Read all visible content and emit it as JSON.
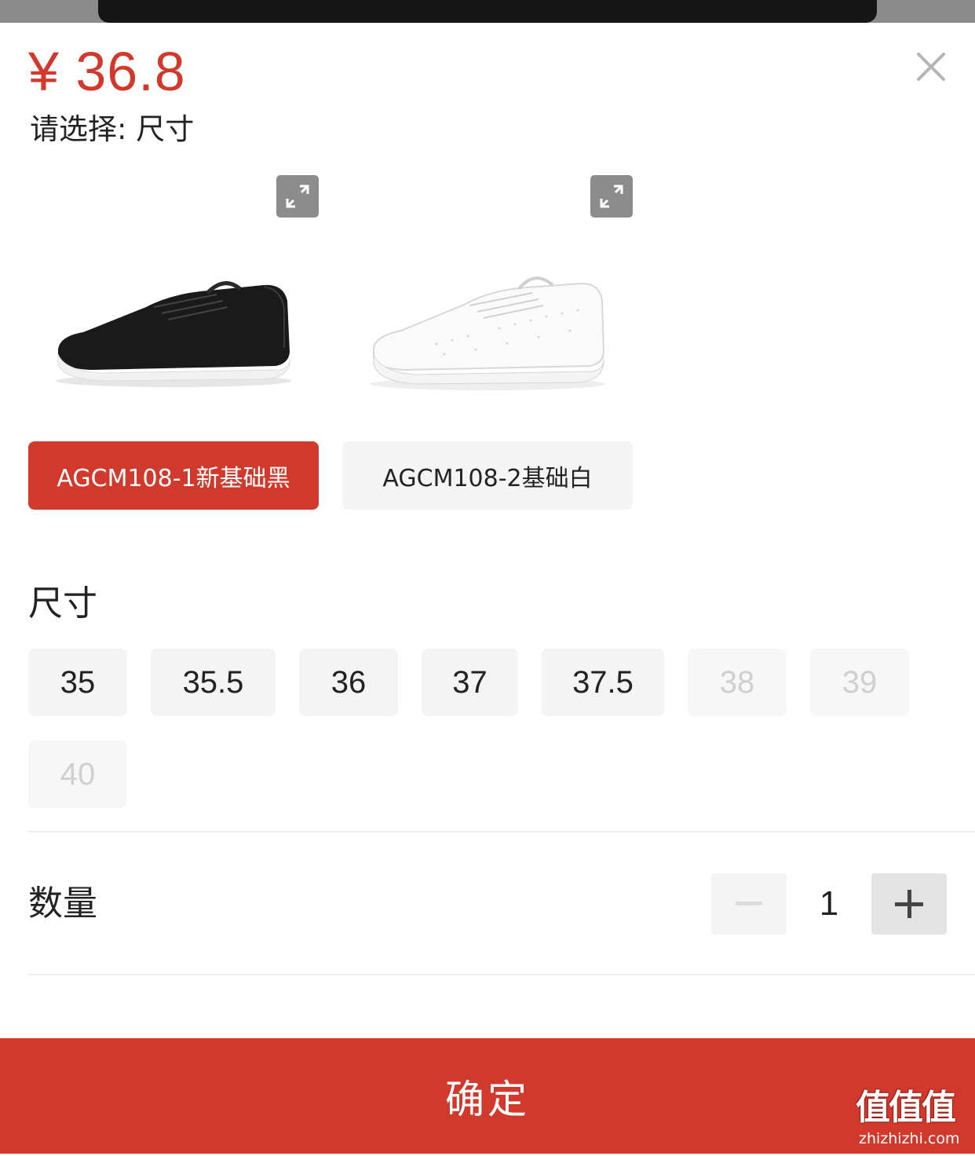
{
  "price": "¥ 36.8",
  "prompt": "请选择: 尺寸",
  "variants": [
    {
      "label": "AGCM108-1新基础黑",
      "selected": true,
      "image": "black-sneaker"
    },
    {
      "label": "AGCM108-2基础白",
      "selected": false,
      "image": "white-sneaker"
    }
  ],
  "size_section": {
    "title": "尺寸",
    "sizes": [
      {
        "label": "35",
        "available": true
      },
      {
        "label": "35.5",
        "available": true
      },
      {
        "label": "36",
        "available": true
      },
      {
        "label": "37",
        "available": true
      },
      {
        "label": "37.5",
        "available": true
      },
      {
        "label": "38",
        "available": false
      },
      {
        "label": "39",
        "available": false
      },
      {
        "label": "40",
        "available": false
      }
    ]
  },
  "quantity": {
    "label": "数量",
    "value": "1"
  },
  "confirm_label": "确定",
  "watermark": {
    "main": "值值值",
    "sub": "zhizhizhi.com"
  },
  "colors": {
    "accent": "#d0392b",
    "chip_bg": "#f4f4f4",
    "disabled_text": "#cfcfcf"
  },
  "icons": {
    "close": "close-icon",
    "zoom": "expand-icon",
    "minus": "minus-icon",
    "plus": "plus-icon"
  }
}
